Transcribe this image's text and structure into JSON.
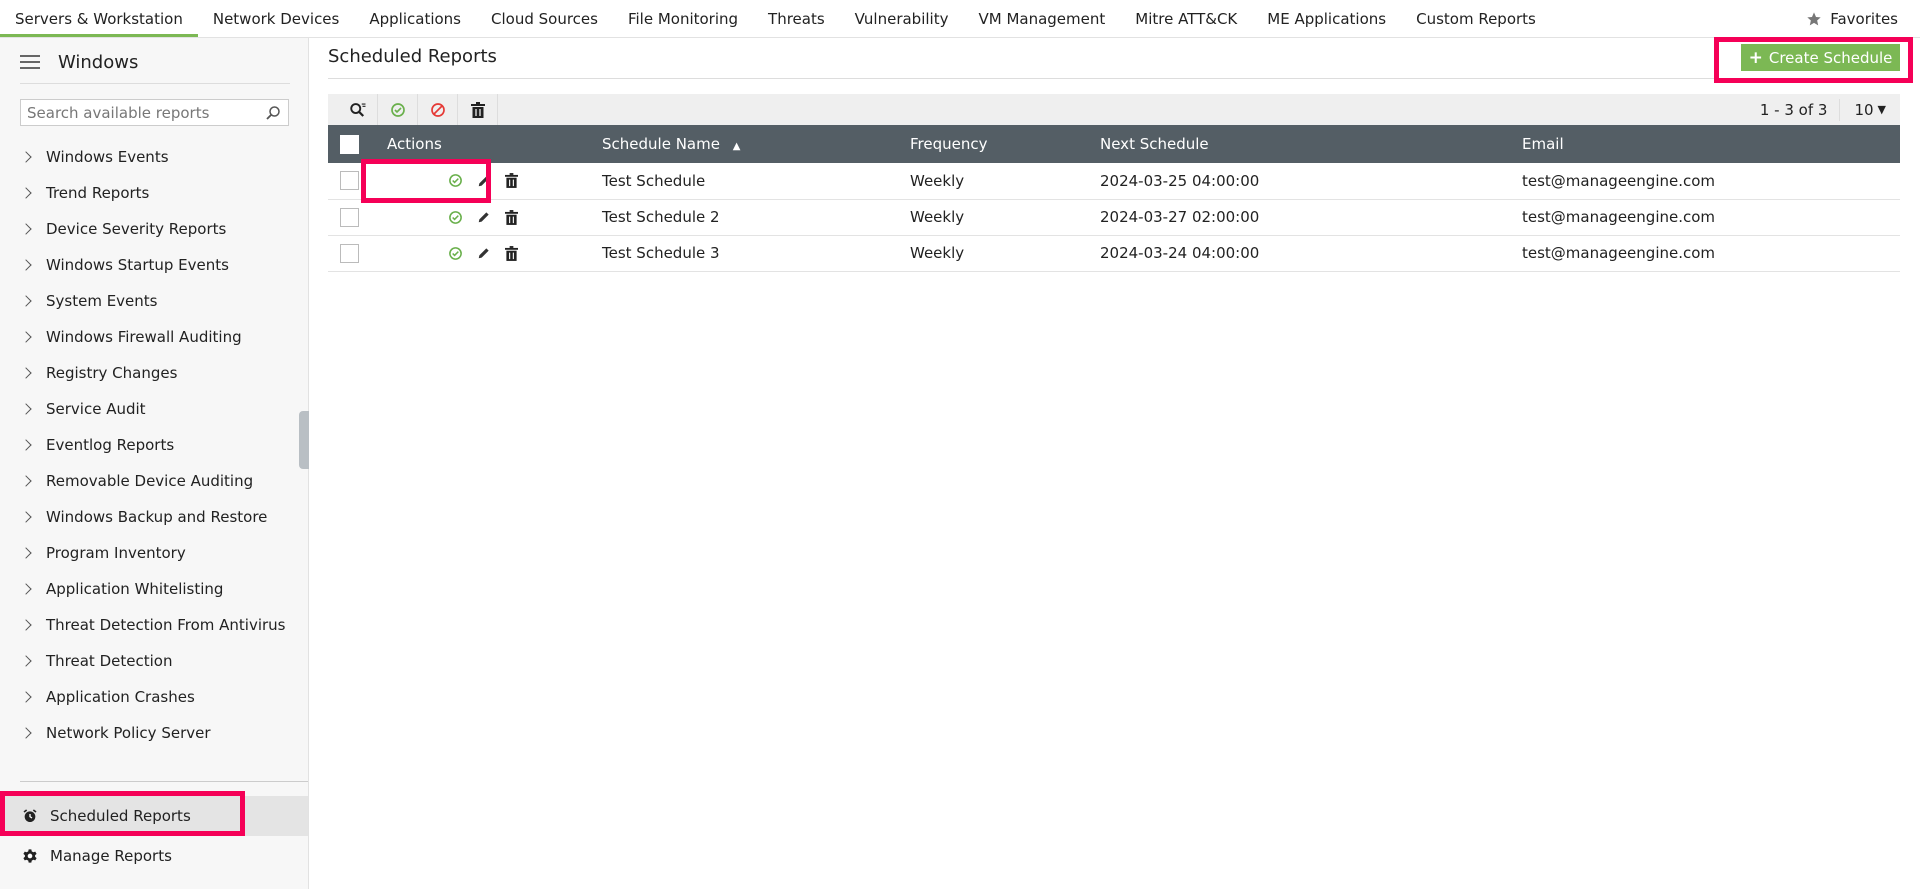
{
  "topnav": {
    "tabs": [
      "Servers & Workstation",
      "Network Devices",
      "Applications",
      "Cloud Sources",
      "File Monitoring",
      "Threats",
      "Vulnerability",
      "VM Management",
      "Mitre ATT&CK",
      "ME Applications",
      "Custom Reports"
    ],
    "favorites": "Favorites"
  },
  "sidebar": {
    "title": "Windows",
    "search_placeholder": "Search available reports",
    "items": [
      "Windows Events",
      "Trend Reports",
      "Device Severity Reports",
      "Windows Startup Events",
      "System Events",
      "Windows Firewall Auditing",
      "Registry Changes",
      "Service Audit",
      "Eventlog Reports",
      "Removable Device Auditing",
      "Windows Backup and Restore",
      "Program Inventory",
      "Application Whitelisting",
      "Threat Detection From Antivirus",
      "Threat Detection",
      "Application Crashes",
      "Network Policy Server"
    ],
    "scheduled_reports": "Scheduled Reports",
    "manage_reports": "Manage Reports"
  },
  "main": {
    "title": "Scheduled Reports",
    "create_label": "Create Schedule",
    "pager": "1 - 3 of 3",
    "page_size": "10",
    "columns": {
      "actions": "Actions",
      "name": "Schedule Name",
      "frequency": "Frequency",
      "next": "Next Schedule",
      "email": "Email"
    },
    "rows": [
      {
        "name": "Test Schedule",
        "frequency": "Weekly",
        "next": "2024-03-25 04:00:00",
        "email": "test@manageengine.com"
      },
      {
        "name": "Test Schedule 2",
        "frequency": "Weekly",
        "next": "2024-03-27 02:00:00",
        "email": "test@manageengine.com"
      },
      {
        "name": "Test Schedule 3",
        "frequency": "Weekly",
        "next": "2024-03-24 04:00:00",
        "email": "test@manageengine.com"
      }
    ]
  },
  "colors": {
    "accent": "#7cb854",
    "header": "#545e65",
    "highlight": "#f50057",
    "disable": "#e53935"
  }
}
